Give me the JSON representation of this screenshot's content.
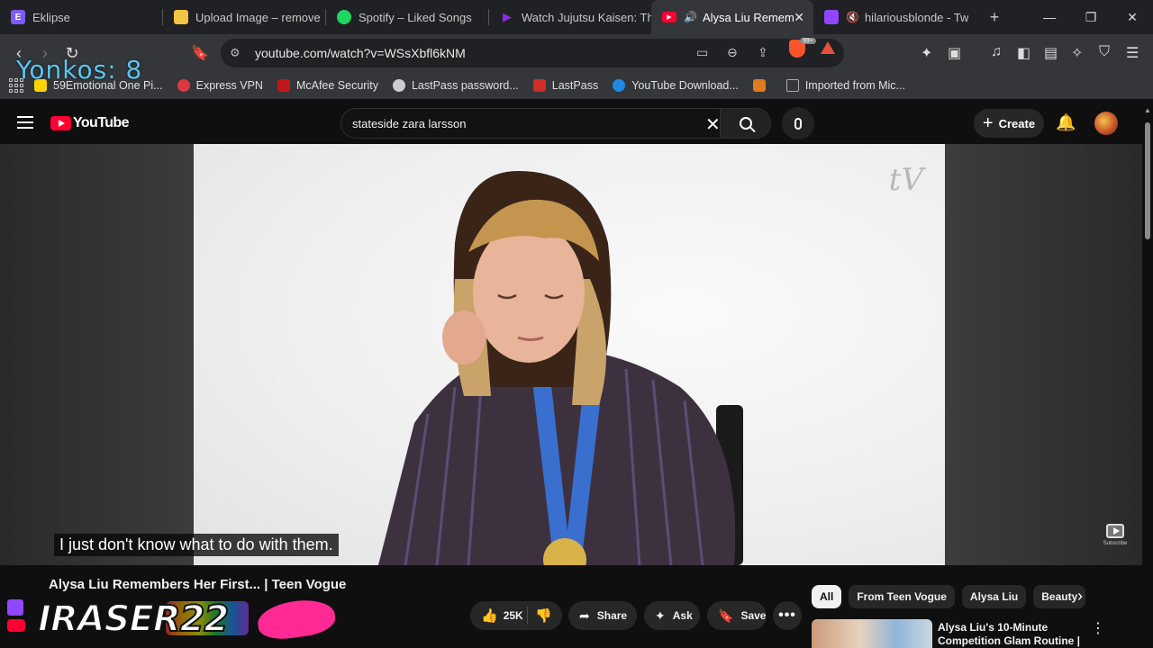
{
  "browser": {
    "tabs": [
      {
        "title": "Eklipse",
        "icon": "eklipse-icon",
        "color": "#7b5cff",
        "active": false
      },
      {
        "title": "Upload Image – remove",
        "icon": "upload-icon",
        "color": "#f4c542",
        "active": false
      },
      {
        "title": "Spotify – Liked Songs",
        "icon": "spotify-icon",
        "color": "#1ed760",
        "active": false
      },
      {
        "title": "Watch Jujutsu Kaisen: Th",
        "icon": "crunchyroll-icon",
        "color": "#8a2be2",
        "active": false
      },
      {
        "title": "Alysa Liu Remem",
        "icon": "youtube-icon",
        "color": "#ff0033",
        "active": true
      },
      {
        "title": "hilariousblonde - Tw",
        "icon": "twitch-icon",
        "color": "#9146ff",
        "active": false
      }
    ],
    "new_tab": "+",
    "url": "youtube.com/watch?v=WSsXbfl6kNM",
    "bookmarks": [
      {
        "label": "59Emotional One Pi...",
        "color": "#ffd400"
      },
      {
        "label": "Express VPN",
        "color": "#da3940"
      },
      {
        "label": "McAfee Security",
        "color": "#c01818"
      },
      {
        "label": "LastPass password...",
        "color": "#cccccc"
      },
      {
        "label": "LastPass",
        "color": "#d32d27"
      },
      {
        "label": "YouTube Download...",
        "color": "#1e88e5"
      },
      {
        "label": "",
        "color": "#e07b22"
      },
      {
        "label": "Imported from Mic...",
        "color": "#aaaaaa"
      }
    ]
  },
  "overlay": {
    "counter": "Yonkos: 8",
    "logo_text": "IRASER22"
  },
  "youtube": {
    "logo": "YouTube",
    "search_query": "stateside zara larsson",
    "create_label": "Create",
    "caption": "I just don't know what to do with them.",
    "watermark": "tV",
    "subscribe_label": "Subscribe",
    "video_title": "Alysa Liu Remembers Her First... | Teen Vogue",
    "likes": "25K",
    "share_label": "Share",
    "ask_label": "Ask",
    "save_label": "Save",
    "chips": [
      "All",
      "From Teen Vogue",
      "Alysa Liu",
      "Beauty"
    ],
    "recommended": {
      "title": "Alysa Liu's 10-Minute Competition Glam Routine | ..."
    }
  },
  "colors": {
    "accent": "#ff0033",
    "background": "#0f0f0f",
    "overlay_text": "#58c7f0"
  }
}
